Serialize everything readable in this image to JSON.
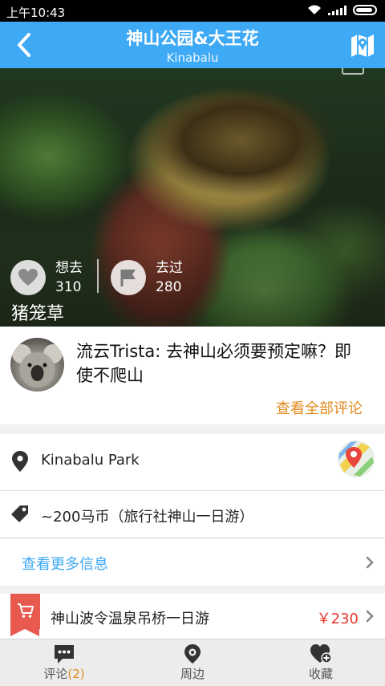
{
  "status_bar": {
    "time": "上午10:43"
  },
  "header": {
    "title": "神山公园&大王花",
    "subtitle": "Kinabalu"
  },
  "hero": {
    "want_label": "想去",
    "want_count": "310",
    "been_label": "去过",
    "been_count": "280",
    "plant_name": "猪笼草"
  },
  "comment": {
    "text": "流云Trista: 去神山必须要预定嘛？即使不爬山",
    "view_all": "查看全部评论"
  },
  "info": {
    "location": "Kinabalu Park",
    "price_info": "~200马币（旅行社神山一日游）",
    "more_info": "查看更多信息"
  },
  "tour": {
    "name": "神山波令温泉吊桥一日游",
    "price": "￥230"
  },
  "tabs": [
    {
      "label": "评论",
      "count": "(2)"
    },
    {
      "label": "周边"
    },
    {
      "label": "收藏"
    }
  ],
  "colors": {
    "accent": "#3ea9f5",
    "orange": "#e08a1e",
    "price_red": "#e8382e",
    "tag_red": "#e85a50"
  },
  "icons": [
    "back-arrow-icon",
    "map-icon",
    "camera-icon",
    "heart-icon",
    "flag-icon",
    "location-pin-icon",
    "map-app-icon",
    "price-tag-icon",
    "chevron-right-icon",
    "cart-icon",
    "comment-icon",
    "nearby-pin-icon",
    "favorite-add-icon",
    "wifi-icon",
    "signal-icon",
    "battery-icon"
  ]
}
